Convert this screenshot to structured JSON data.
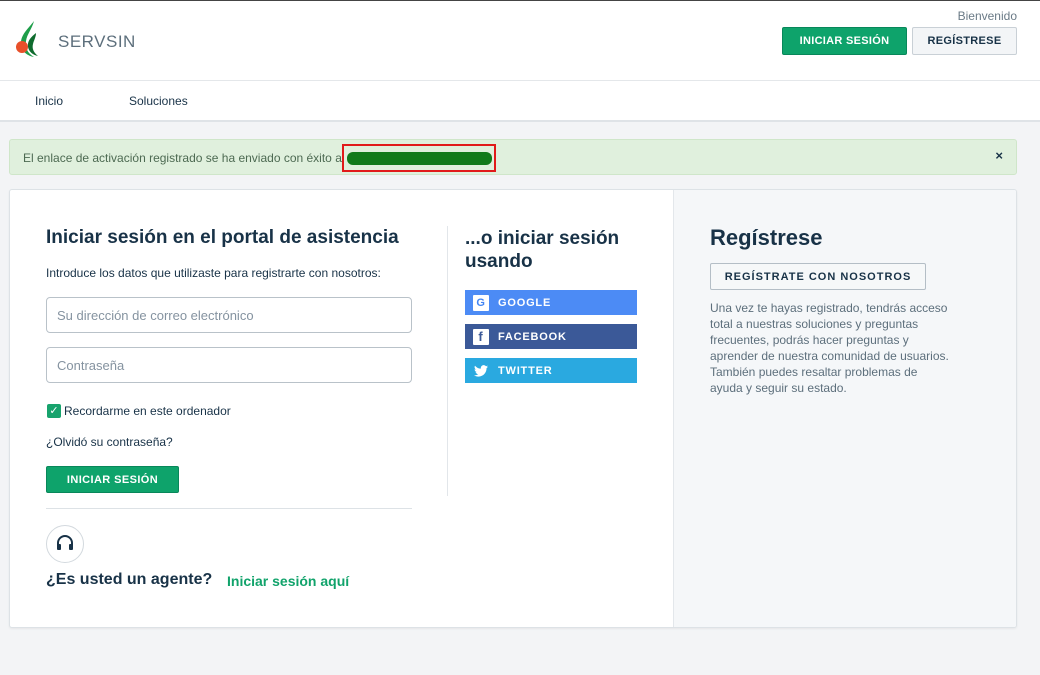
{
  "header": {
    "brand": "SERVSIN",
    "welcome": "Bienvenido",
    "login_button": "INICIAR SESIÓN",
    "register_button": "REGÍSTRESE"
  },
  "nav": {
    "items": [
      {
        "label": "Inicio"
      },
      {
        "label": "Soluciones"
      }
    ]
  },
  "alert": {
    "message": "El enlace de activación registrado se ha enviado con éxito a",
    "close": "×"
  },
  "login": {
    "title": "Iniciar sesión en el portal de asistencia",
    "subtitle": "Introduce los datos que utilizaste para registrarte con nosotros:",
    "email_placeholder": "Su dirección de correo electrónico",
    "password_placeholder": "Contraseña",
    "remember_label": "Recordarme en este ordenador",
    "remember_checked": true,
    "forgot": "¿Olvidó su contraseña?",
    "submit": "INICIAR SESIÓN",
    "agent_question": "¿Es usted un agente?",
    "agent_link": "Iniciar sesión aquí"
  },
  "social": {
    "title": "...o iniciar sesión usando",
    "google": "GOOGLE",
    "facebook": "FACEBOOK",
    "twitter": "TWITTER"
  },
  "register": {
    "title": "Regístrese",
    "button": "REGÍSTRATE CON NOSOTROS",
    "description": "Una vez te hayas registrado, tendrás acceso total a nuestras soluciones y preguntas frecuentes, podrás hacer preguntas y aprender de nuestra comunidad de usuarios. También puedes resaltar problemas de ayuda y seguir su estado."
  },
  "colors": {
    "primary_green": "#0ea36b",
    "google_blue": "#4c8bf5",
    "facebook_blue": "#3b5998",
    "twitter_blue": "#2aa9e0",
    "alert_bg": "#e0f0dd",
    "highlight_red": "#e11a1a"
  }
}
